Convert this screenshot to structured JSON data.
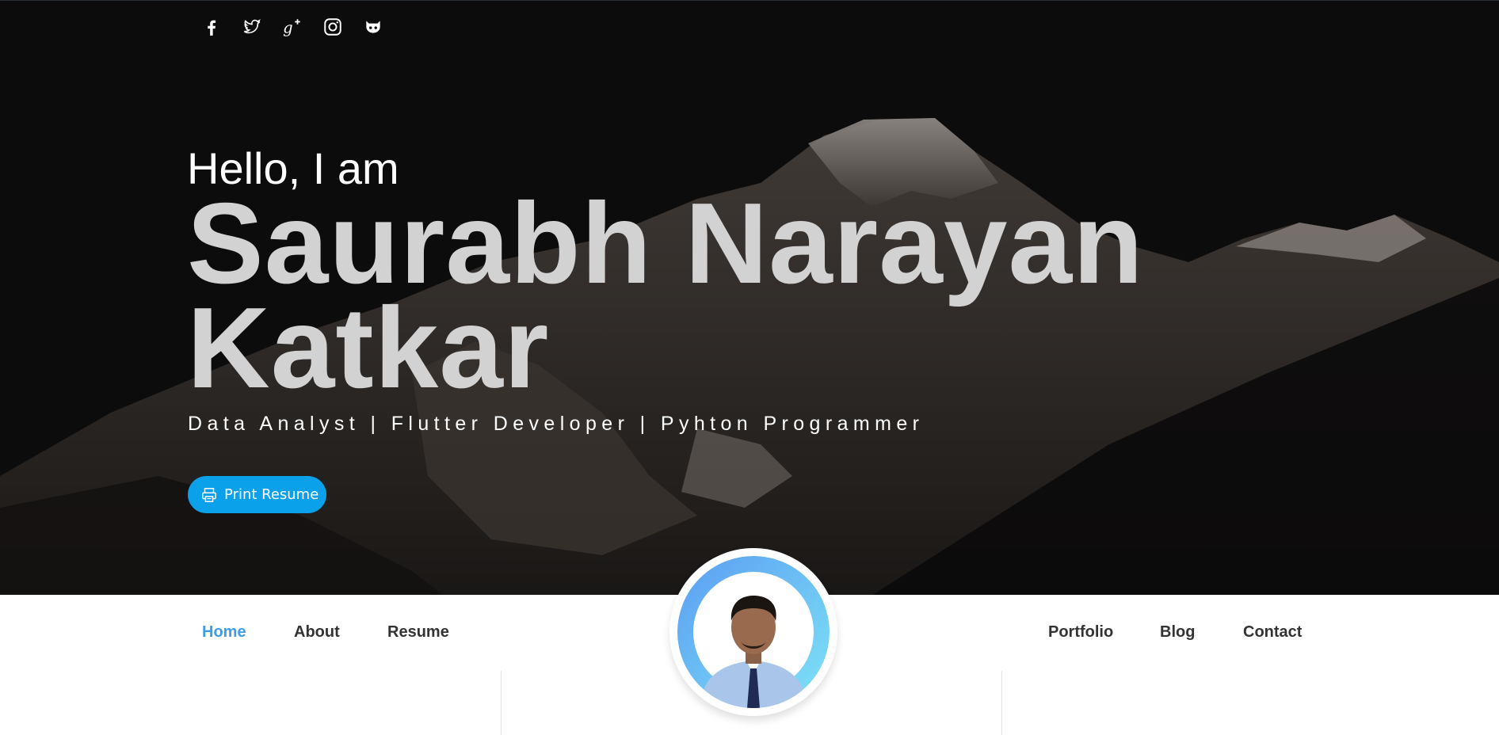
{
  "social": [
    {
      "icon": "facebook-icon"
    },
    {
      "icon": "twitter-icon"
    },
    {
      "icon": "google-plus-icon"
    },
    {
      "icon": "instagram-icon"
    },
    {
      "icon": "github-icon"
    }
  ],
  "hero": {
    "greeting": "Hello, I am",
    "name_line1": "Saurabh Narayan",
    "name_line2": "Katkar",
    "tagline": "Data Analyst | Flutter Developer | Pyhton Programmer",
    "print_button": "Print Resume",
    "print_icon": "printer-icon"
  },
  "nav": {
    "left": [
      {
        "label": "Home",
        "active": true
      },
      {
        "label": "About",
        "active": false
      },
      {
        "label": "Resume",
        "active": false
      }
    ],
    "right": [
      {
        "label": "Portfolio",
        "active": false
      },
      {
        "label": "Blog",
        "active": false
      },
      {
        "label": "Contact",
        "active": false
      }
    ]
  },
  "colors": {
    "accent": "#0ba0ea",
    "nav_active": "#3d9be9",
    "hero_bg": "#0d0c0d",
    "name_text": "#d2d2d2"
  }
}
